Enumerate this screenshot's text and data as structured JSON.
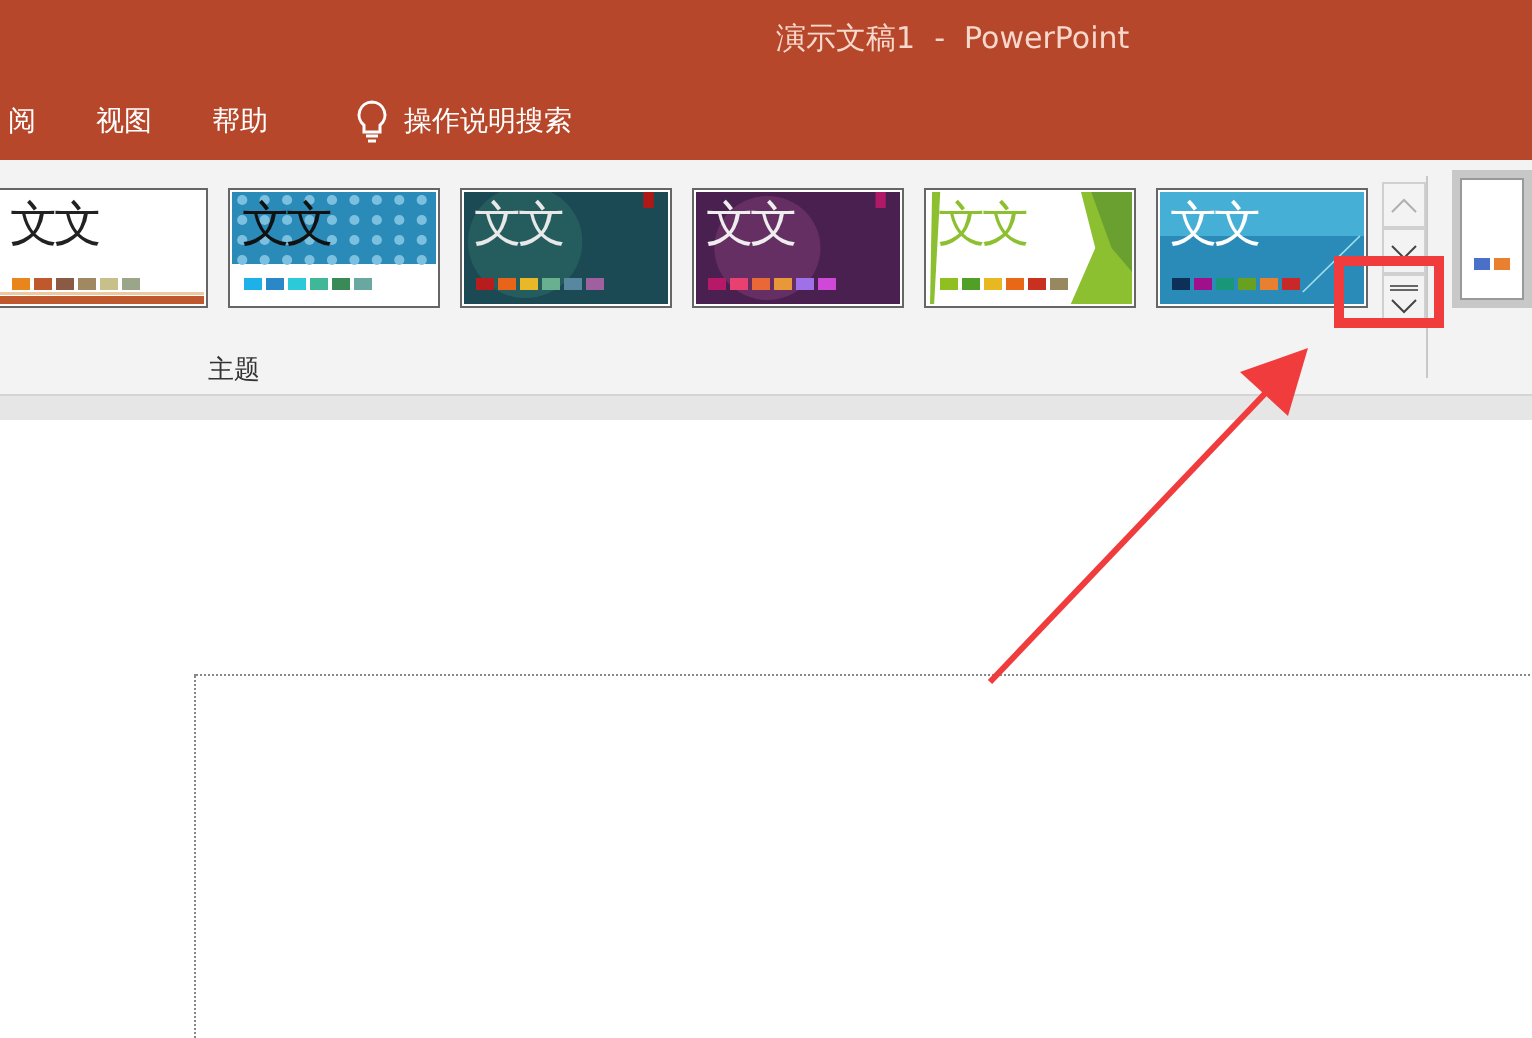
{
  "window": {
    "title": "演示文稿1  -  PowerPoint"
  },
  "tabs": [
    {
      "label": "阅",
      "selected": false
    },
    {
      "label": "视图",
      "selected": false
    },
    {
      "label": "帮助",
      "selected": false
    }
  ],
  "search": {
    "label": "操作说明搜索"
  },
  "themes": [
    {
      "kind": "office",
      "sample": "文文",
      "selected": false,
      "swatches": [
        {
          "color": "#e8861c"
        },
        {
          "color": "#c0582e"
        },
        {
          "color": "#8a5a45"
        },
        {
          "color": "#a08860"
        },
        {
          "color": "#c8c08a"
        },
        {
          "color": "#9aa58a"
        }
      ]
    },
    {
      "kind": "pattern",
      "sample": "文文",
      "selected": false,
      "swatches": [
        {
          "color": "#1eb0e8"
        },
        {
          "color": "#2a88c8"
        },
        {
          "color": "#2ccad8"
        },
        {
          "color": "#40b898"
        },
        {
          "color": "#3a8a58"
        },
        {
          "color": "#68a8a0"
        }
      ]
    },
    {
      "kind": "teal",
      "sample": "文文",
      "selected": false,
      "swatches": [
        {
          "color": "#b81c1c"
        },
        {
          "color": "#e86418"
        },
        {
          "color": "#e8b828"
        },
        {
          "color": "#68b090"
        },
        {
          "color": "#5888a0"
        },
        {
          "color": "#a060a0"
        }
      ]
    },
    {
      "kind": "purple",
      "sample": "文文",
      "selected": false,
      "swatches": [
        {
          "color": "#b81868"
        },
        {
          "color": "#e84070"
        },
        {
          "color": "#e86838"
        },
        {
          "color": "#e89838"
        },
        {
          "color": "#a070e8"
        },
        {
          "color": "#d048d8"
        }
      ]
    },
    {
      "kind": "green",
      "sample": "文文",
      "selected": false,
      "swatches": [
        {
          "color": "#90c020"
        },
        {
          "color": "#50a028"
        },
        {
          "color": "#e8b820"
        },
        {
          "color": "#e86818"
        },
        {
          "color": "#c83020"
        },
        {
          "color": "#988860"
        }
      ]
    },
    {
      "kind": "blue",
      "sample": "文文",
      "selected": false,
      "swatches": [
        {
          "color": "#0c3058"
        },
        {
          "color": "#a0108a"
        },
        {
          "color": "#189878"
        },
        {
          "color": "#68a020"
        },
        {
          "color": "#e88030"
        },
        {
          "color": "#c82828"
        }
      ]
    }
  ],
  "gallery": {
    "label": "主题"
  },
  "variant_swatches": [
    {
      "color": "#4a70c8"
    },
    {
      "color": "#e88030"
    }
  ]
}
